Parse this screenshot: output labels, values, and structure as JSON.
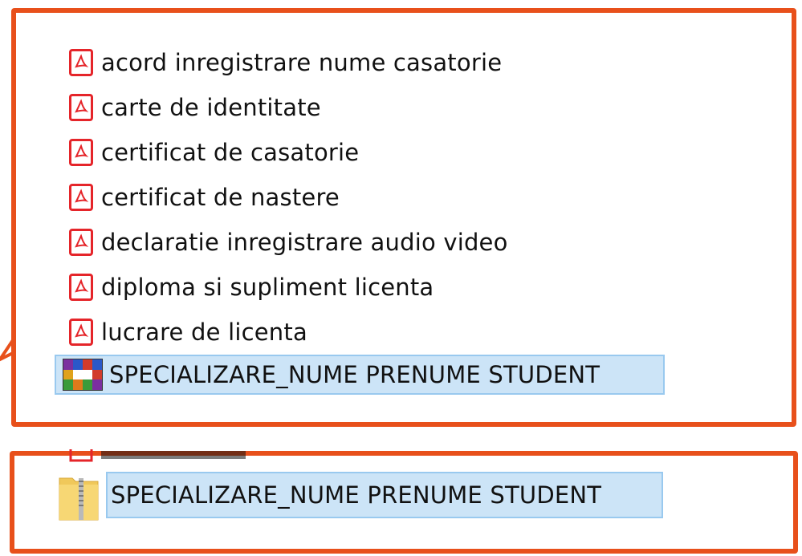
{
  "files": [
    {
      "name": "acord inregistrare nume casatorie",
      "icon": "pdf-icon"
    },
    {
      "name": "carte de identitate",
      "icon": "pdf-icon"
    },
    {
      "name": "certificat de casatorie",
      "icon": "pdf-icon"
    },
    {
      "name": "certificat de nastere",
      "icon": "pdf-icon"
    },
    {
      "name": "declaratie inregistrare audio video",
      "icon": "pdf-icon"
    },
    {
      "name": "diploma si supliment licenta",
      "icon": "pdf-icon"
    },
    {
      "name": "lucrare de licenta",
      "icon": "pdf-icon"
    }
  ],
  "archive_rar": {
    "name": "SPECIALIZARE_NUME PRENUME STUDENT",
    "icon": "winrar-archive-icon",
    "selected": true
  },
  "archive_zip": {
    "name": "SPECIALIZARE_NUME PRENUME STUDENT",
    "icon": "zip-folder-icon",
    "selected": true
  },
  "colors": {
    "highlight": "#e8501b",
    "selection": "#cce4f7",
    "selection_border": "#99c9ef",
    "pdf": "#e5252a"
  }
}
